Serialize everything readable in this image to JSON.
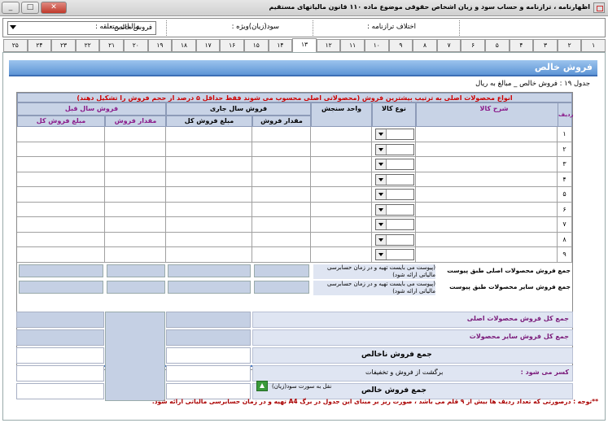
{
  "window": {
    "title": "اظهارنامه ، ترازنامه و حساب سود و زیان اشخاص حقوقی موضوع ماده ۱۱۰ قانون مالیاتهای مستقیم",
    "btn_min": "_",
    "btn_max": "□",
    "btn_close": "✕"
  },
  "info": {
    "combo_value": "فروش خالص",
    "label_diff": "اختلاف ترازنامه :",
    "label_profit": "سود(زیان)ویژه :",
    "label_tax": "مالیات متعلقه :"
  },
  "tabs": [
    "۱",
    "۲",
    "۳",
    "۴",
    "۵",
    "۶",
    "۷",
    "۸",
    "۹",
    "۱۰",
    "۱۱",
    "۱۲",
    "۱۳",
    "۱۴",
    "۱۵",
    "۱۶",
    "۱۷",
    "۱۸",
    "۱۹",
    "۲۰",
    "۲۱",
    "۲۲",
    "۲۳",
    "۲۴",
    "۲۵"
  ],
  "active_tab": 13,
  "section_title": "فروش خالص",
  "table_caption": "جدول ۱۹ : فروش خالص _ مبالغ به ریال",
  "red_header": "انواع محصولات اصلی به ترتیب بیشترین فروش (محصولاتی اصلی محسوب می شوند فقط حداقل ۵ درصد از حجم فروش را تشکیل دهند)",
  "headers": {
    "row_num": "ردیف",
    "desc": "شرح کالا",
    "type": "نوع کالا",
    "unit": "واحد سنجش",
    "current_year": "فروش سال جاری",
    "prev_year": "فروش سال قبل",
    "qty": "مقدار فروش",
    "amount": "مبلغ فروش کل"
  },
  "rows": [
    "۱",
    "۲",
    "۳",
    "۴",
    "۵",
    "۶",
    "۷",
    "۸",
    "۹"
  ],
  "sum_main_appendix": "جمع فروش محصولات اصلی طبق پیوست",
  "sum_other_appendix": "جمع فروش سایر محصولات طبق پیوست",
  "appendix_note": "(پیوست می بایست تهیه و در زمان حسابرسی مالیاتی ارائه شود)",
  "sum_main": "جمع کل فروش محصولات اصلی",
  "sum_other": "جمع کل فروش سایر محصولات",
  "gross_sales": "جمع فروش ناخالص",
  "deductions_label": "کسر می شود :",
  "returns": "برگشت از فروش و تخفیفات",
  "net_sales": "جمع فروش خالص",
  "transfer_note": "نقل به سورت سود(زیان)",
  "footnote": "**توجه : درصورتی که تعداد ردیف ها بیش از ۹ قلم می باشد ، صورت ریز بر مبنای این جدول در برگ A4 تهیه و در زمان حسابرسی مالیاتی ارائه شود."
}
